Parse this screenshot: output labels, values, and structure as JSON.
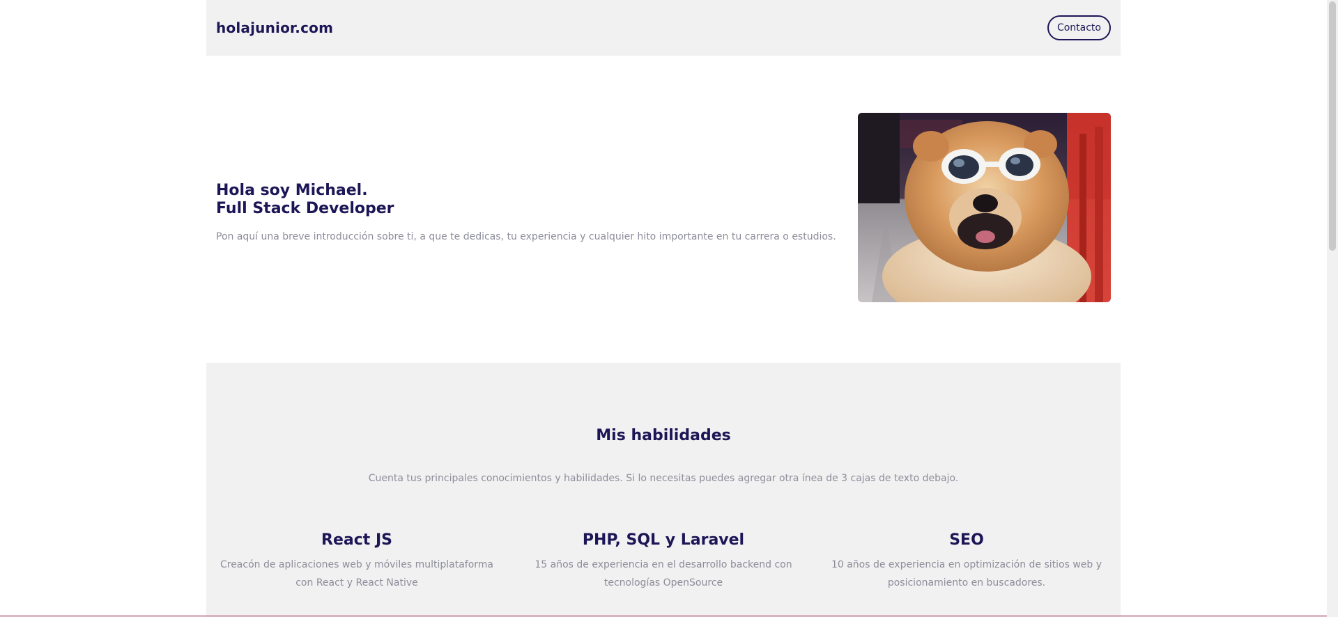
{
  "header": {
    "logo": "holajunior.com",
    "contact_label": "Contacto"
  },
  "hero": {
    "title_line1": "Hola soy Michael.",
    "title_line2": "Full Stack Developer",
    "description": "Pon aquí una breve introducción sobre ti, a que te dedicas, tu experiencia y cualquier hito importante en tu carrera o estudios.",
    "image_icon": "dog-with-sunglasses-photo"
  },
  "skills": {
    "title": "Mis habilidades",
    "description": "Cuenta tus principales conocimientos y habilidades. Si lo necesitas puedes agregar otra ínea de 3 cajas de texto debajo.",
    "items": [
      {
        "title": "React JS",
        "line1": "Creacón de aplicaciones web y móviles multiplataforma",
        "line2": "con React y React Native"
      },
      {
        "title": "PHP, SQL y Laravel",
        "line1": "15 años de experiencia en el desarrollo backend con",
        "line2": "tecnologías OpenSource"
      },
      {
        "title": "SEO",
        "line1": "10 años de experiencia en optimización de sitios web y",
        "line2": "posicionamiento en buscadores."
      }
    ]
  },
  "colors": {
    "primary": "#1c1656",
    "muted_text": "#8d8d9b",
    "section_bg": "#f1f1f1"
  }
}
